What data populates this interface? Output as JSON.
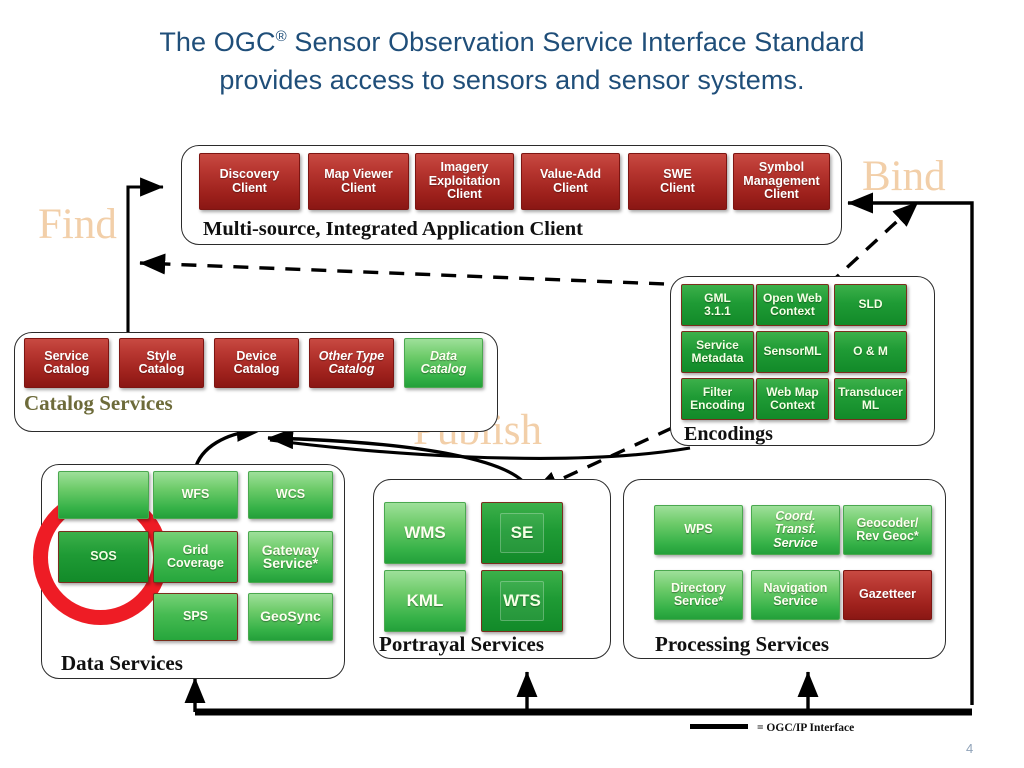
{
  "title": {
    "line1_pre": "The OGC",
    "line1_sup": "®",
    "line1_post": " Sensor Observation Service Interface Standard",
    "line2": "provides access to sensors and sensor systems."
  },
  "flow_labels": {
    "find": "Find",
    "bind": "Bind",
    "publish": "Publish"
  },
  "client_group": {
    "label": "Multi-source, Integrated Application Client",
    "boxes": [
      {
        "label": "Discovery\nClient",
        "style": "red"
      },
      {
        "label": "Map Viewer\nClient",
        "style": "red"
      },
      {
        "label": "Imagery\nExploitation\nClient",
        "style": "red"
      },
      {
        "label": "Value-Add\nClient",
        "style": "red"
      },
      {
        "label": "SWE\nClient",
        "style": "red"
      },
      {
        "label": "Symbol\nManagement\nClient",
        "style": "red"
      }
    ]
  },
  "catalog_services": {
    "label": "Catalog Services",
    "boxes": [
      {
        "label": "Service\nCatalog",
        "style": "red",
        "italic": false
      },
      {
        "label": "Style\nCatalog",
        "style": "red",
        "italic": false
      },
      {
        "label": "Device\nCatalog",
        "style": "red",
        "italic": false
      },
      {
        "label": "Other Type\nCatalog",
        "style": "red",
        "italic": true
      },
      {
        "label": "Data\nCatalog",
        "style": "green",
        "italic": true
      }
    ]
  },
  "encodings": {
    "label": "Encodings",
    "boxes": [
      {
        "label": "GML\n3.1.1",
        "style": "greendark"
      },
      {
        "label": "Open Web\nContext",
        "style": "greendark"
      },
      {
        "label": "SLD",
        "style": "greendark"
      },
      {
        "label": "Service\nMetadata",
        "style": "greendark"
      },
      {
        "label": "SensorML",
        "style": "greendark"
      },
      {
        "label": "O & M",
        "style": "greendark"
      },
      {
        "label": "Filter\nEncoding",
        "style": "greendark"
      },
      {
        "label": "Web Map\nContext",
        "style": "greendark"
      },
      {
        "label": "Transducer\nML",
        "style": "greendark"
      }
    ]
  },
  "data_services": {
    "label": "Data Services",
    "boxes": [
      {
        "label": "",
        "style": "green",
        "note": "obscured-by-annotation-circle"
      },
      {
        "label": "WFS",
        "style": "green"
      },
      {
        "label": "WCS",
        "style": "green"
      },
      {
        "label": "SOS",
        "style": "greendark",
        "highlighted": true
      },
      {
        "label": "Grid\nCoverage",
        "style": "greenmid"
      },
      {
        "label": "Gateway\nService*",
        "style": "green"
      },
      {
        "label": "SPS",
        "style": "greenmid"
      },
      {
        "label": "GeoSync",
        "style": "green"
      }
    ]
  },
  "portrayal_services": {
    "label": "Portrayal Services",
    "boxes": [
      {
        "label": "WMS",
        "style": "green"
      },
      {
        "label": "SE",
        "style": "greendark",
        "inset": true
      },
      {
        "label": "KML",
        "style": "green"
      },
      {
        "label": "WTS",
        "style": "greendark",
        "inset": true
      }
    ]
  },
  "processing_services": {
    "label": "Processing Services",
    "boxes": [
      {
        "label": "WPS",
        "style": "green",
        "italic": false
      },
      {
        "label": "Coord.\nTransf.\nService",
        "style": "green",
        "italic": true
      },
      {
        "label": "Geocoder/\nRev Geoc*",
        "style": "green",
        "italic": false
      },
      {
        "label": "Directory\nService*",
        "style": "green",
        "italic": false
      },
      {
        "label": "Navigation\nService",
        "style": "green",
        "italic": false
      },
      {
        "label": "Gazetteer",
        "style": "red",
        "italic": false
      }
    ]
  },
  "footer": {
    "legend_text": "= OGC/IP Interface",
    "page_number": "4"
  },
  "colors": {
    "title_blue": "#1f4e79",
    "flow_label_tan": "#f2cfa9",
    "red_box": "#b83731",
    "green_box": "#36b248",
    "green_dark_box": "#128a29",
    "annotation_red": "#ee1c25",
    "group_border": "#2b2b2b"
  }
}
